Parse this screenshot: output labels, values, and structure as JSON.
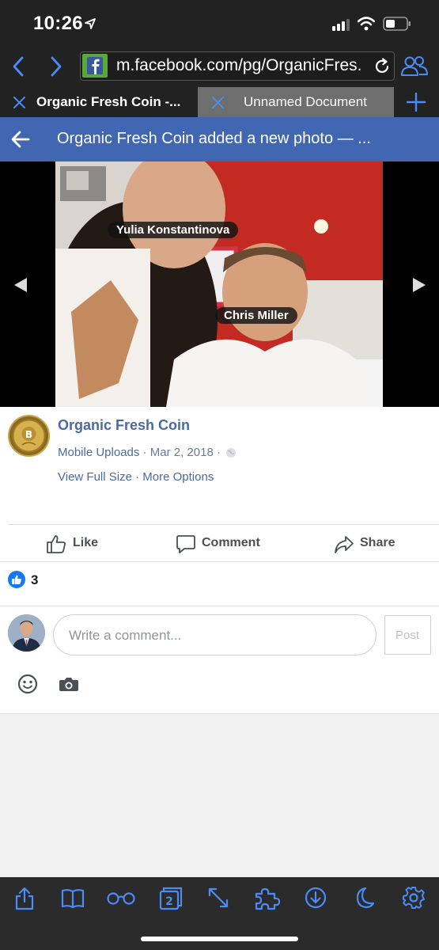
{
  "status": {
    "time": "10:26"
  },
  "browser": {
    "url": "m.facebook.com/pg/OrganicFres...",
    "tabs": [
      {
        "label": "Organic Fresh Coin -..."
      },
      {
        "label": "Unnamed Document"
      }
    ]
  },
  "header": {
    "title": "Organic Fresh Coin added a new photo — ..."
  },
  "photo": {
    "tags": [
      "Yulia Konstantinova",
      "Chris Miller"
    ]
  },
  "post": {
    "page_name": "Organic Fresh Coin",
    "source": "Mobile Uploads",
    "dot1": " · ",
    "date": "Mar 2, 2018",
    "dot2": " · ",
    "view_full_size": "View Full Size",
    "dot3": " · ",
    "more_options": "More Options"
  },
  "actions": {
    "like": "Like",
    "comment": "Comment",
    "share": "Share"
  },
  "reactions": {
    "count": "3"
  },
  "comment_box": {
    "placeholder": "Write a comment...",
    "post_label": "Post"
  },
  "colors": {
    "facebook_blue": "#4267b2",
    "ios_blue": "#4a8bf5",
    "link_text": "#4b6aa0"
  }
}
